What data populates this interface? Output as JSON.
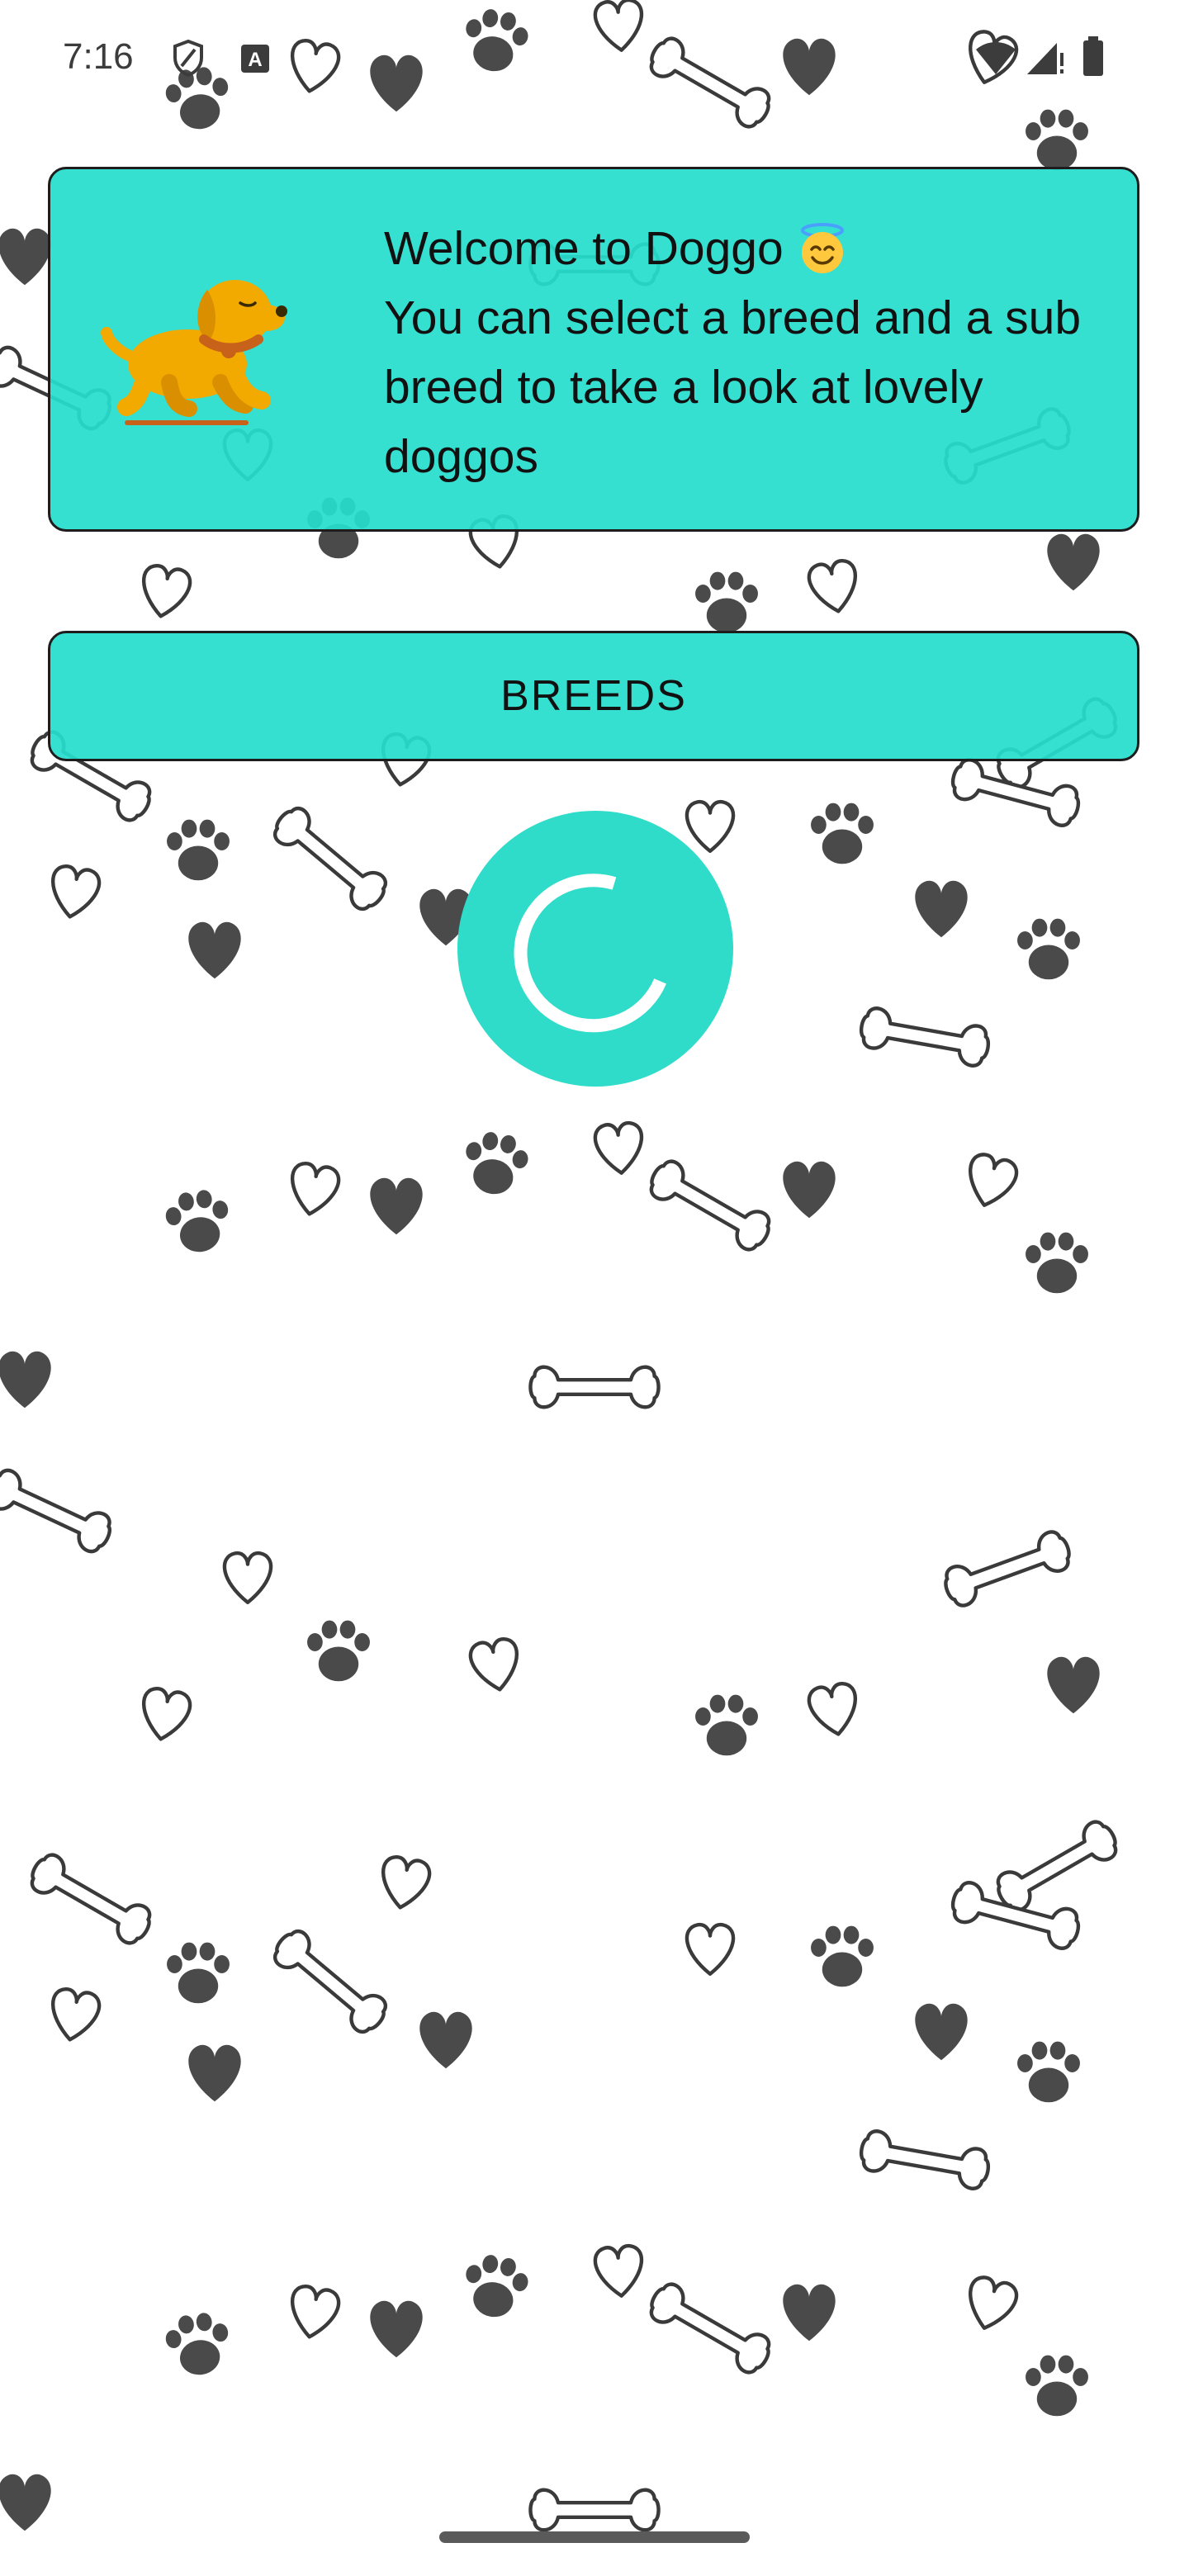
{
  "status_bar": {
    "time": "7:16",
    "icons": [
      "shield-icon",
      "keyboard-a-icon",
      "wifi-icon",
      "signal-icon",
      "battery-icon"
    ]
  },
  "welcome_card": {
    "title": "Welcome to Doggo",
    "title_emoji": "smiling-face-with-halo-icon",
    "message": "You can select a breed and a sub breed to take a look at lovely doggos",
    "illustration": "dog-icon"
  },
  "breeds_button": {
    "label": "BREEDS"
  },
  "loading_indicator": {
    "icon": "loading-spinner-icon"
  },
  "background": {
    "pattern": [
      "paw-icon",
      "bone-icon",
      "heart-icon"
    ]
  },
  "colors": {
    "accent": "#26DECE",
    "pattern": "#4a4a4a",
    "dog": "#F2A900",
    "collar": "#C8611A"
  }
}
